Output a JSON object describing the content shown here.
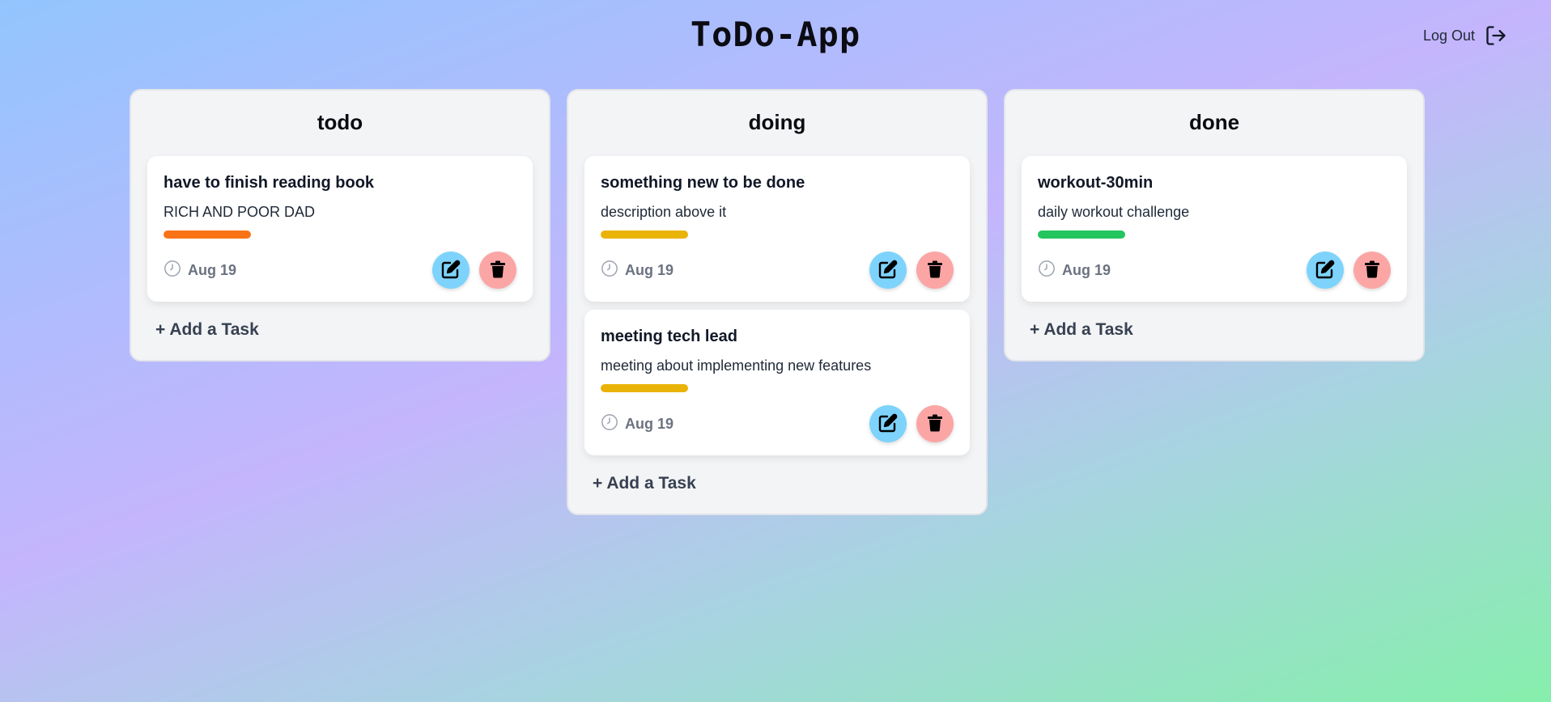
{
  "header": {
    "title": "ToDo-App",
    "logout_label": "Log Out"
  },
  "columns": [
    {
      "title": "todo",
      "add_label": "+ Add a Task",
      "cards": [
        {
          "title": "have to finish reading book",
          "description": "RICH AND POOR DAD",
          "priority_color": "#f97316",
          "date": "Aug 19"
        }
      ]
    },
    {
      "title": "doing",
      "add_label": "+ Add a Task",
      "cards": [
        {
          "title": "something new to be done",
          "description": "description above it",
          "priority_color": "#eab308",
          "date": "Aug 19"
        },
        {
          "title": "meeting tech lead",
          "description": "meeting about implementing new features",
          "priority_color": "#eab308",
          "date": "Aug 19"
        }
      ]
    },
    {
      "title": "done",
      "add_label": "+ Add a Task",
      "cards": [
        {
          "title": "workout-30min",
          "description": "daily workout challenge",
          "priority_color": "#22c55e",
          "date": "Aug 19"
        }
      ]
    }
  ],
  "icons": {
    "logout": "logout-icon",
    "clock": "clock-icon",
    "edit": "edit-icon",
    "delete": "trash-icon"
  },
  "colors": {
    "edit_button": "#7dd3fc",
    "delete_button": "#fca5a5"
  }
}
